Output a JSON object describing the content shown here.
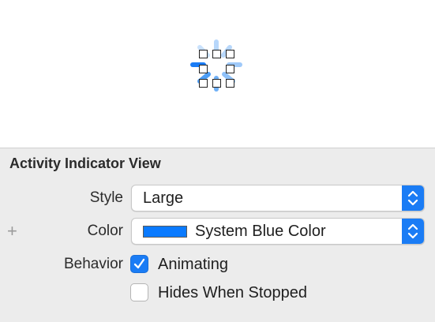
{
  "inspector": {
    "title": "Activity Indicator View",
    "style": {
      "label": "Style",
      "value": "Large"
    },
    "color": {
      "label": "Color",
      "value": "System Blue Color",
      "swatch": "#0a7aff"
    },
    "behavior": {
      "label": "Behavior",
      "animating": {
        "label": "Animating",
        "checked": true
      },
      "hides_when_stopped": {
        "label": "Hides When Stopped",
        "checked": false
      }
    },
    "add_icon": "+"
  },
  "colors": {
    "accent": "#1a7cf5",
    "spinner": "#1a7cf5"
  },
  "icons": [
    "plus-icon",
    "popup-stepper-icon",
    "checkmark-icon"
  ]
}
